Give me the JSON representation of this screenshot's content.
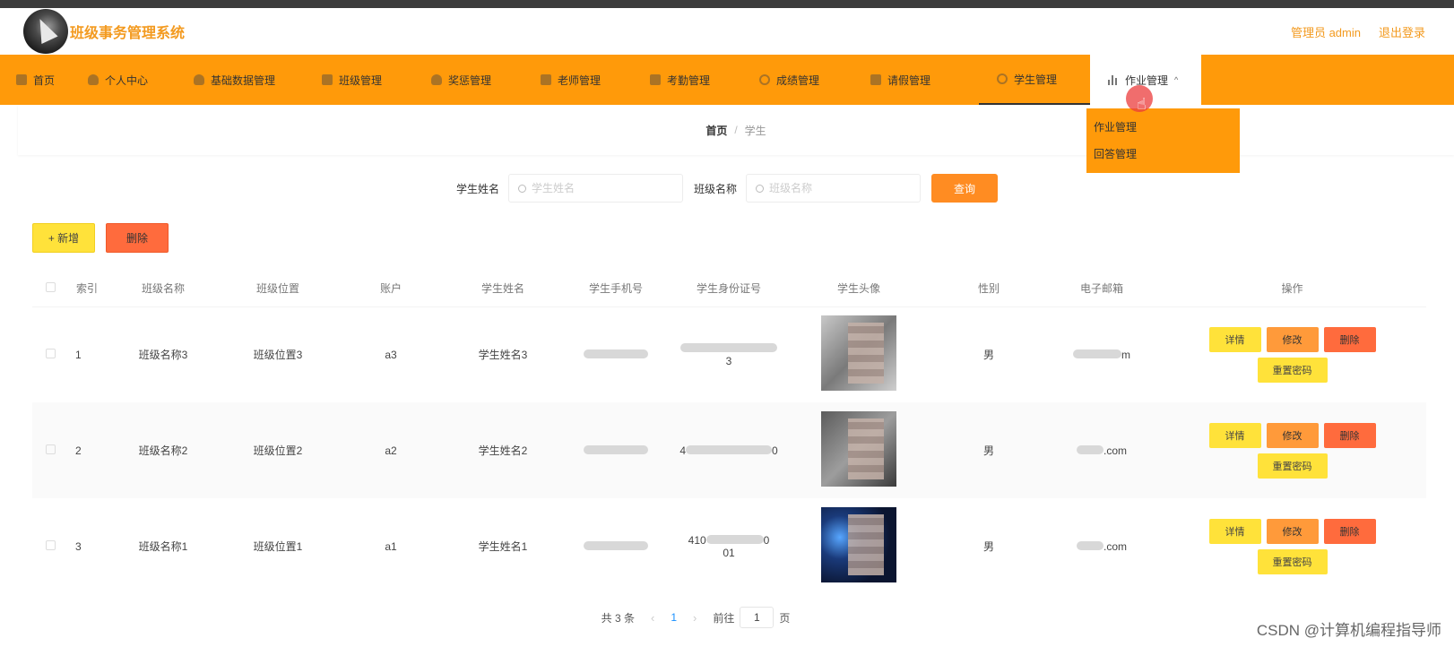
{
  "app": {
    "title": "班级事务管理系统"
  },
  "header": {
    "admin": "管理员 admin",
    "logout": "退出登录"
  },
  "nav": [
    {
      "label": "首页",
      "icon": "home-icon"
    },
    {
      "label": "个人中心",
      "icon": "user-icon"
    },
    {
      "label": "基础数据管理",
      "icon": "user-icon"
    },
    {
      "label": "班级管理",
      "icon": "grid-icon"
    },
    {
      "label": "奖惩管理",
      "icon": "user-icon"
    },
    {
      "label": "老师管理",
      "icon": "grid-icon"
    },
    {
      "label": "考勤管理",
      "icon": "grid-icon"
    },
    {
      "label": "成绩管理",
      "icon": "clock-icon"
    },
    {
      "label": "请假管理",
      "icon": "grid-icon"
    },
    {
      "label": "学生管理",
      "icon": "ring-icon"
    },
    {
      "label": "作业管理",
      "icon": "bar-chart-icon"
    }
  ],
  "dropdown": {
    "items": [
      "作业管理",
      "回答管理"
    ]
  },
  "breadcrumb": {
    "home": "首页",
    "sep": "/",
    "current": "学生"
  },
  "search": {
    "name_label": "学生姓名",
    "name_placeholder": "学生姓名",
    "class_label": "班级名称",
    "class_placeholder": "班级名称",
    "query_button": "查询"
  },
  "actions": {
    "add": "+ 新增",
    "delete": "删除"
  },
  "table": {
    "headers": [
      "索引",
      "班级名称",
      "班级位置",
      "账户",
      "学生姓名",
      "学生手机号",
      "学生身份证号",
      "学生头像",
      "性别",
      "电子邮箱",
      "操作"
    ],
    "rows": [
      {
        "index": "1",
        "class_name": "班级名称3",
        "class_pos": "班级位置3",
        "account": "a3",
        "student": "学生姓名3",
        "id_suffix": "3",
        "gender": "男",
        "email_suffix": "m"
      },
      {
        "index": "2",
        "class_name": "班级名称2",
        "class_pos": "班级位置2",
        "account": "a2",
        "student": "学生姓名2",
        "id_prefix": "4",
        "id_suffix": "0",
        "gender": "男",
        "email_suffix": ".com"
      },
      {
        "index": "3",
        "class_name": "班级名称1",
        "class_pos": "班级位置1",
        "account": "a1",
        "student": "学生姓名1",
        "id_prefix": "410",
        "id_suffix": "0",
        "id_line2": "01",
        "gender": "男",
        "email_suffix": ".com"
      }
    ],
    "ops": {
      "detail": "详情",
      "edit": "修改",
      "delete": "删除",
      "reset": "重置密码"
    }
  },
  "pager": {
    "total": "共 3 条",
    "page": "1",
    "goto": "前往",
    "goto_value": "1",
    "unit": "页"
  },
  "watermark": "CSDN @计算机编程指导师"
}
